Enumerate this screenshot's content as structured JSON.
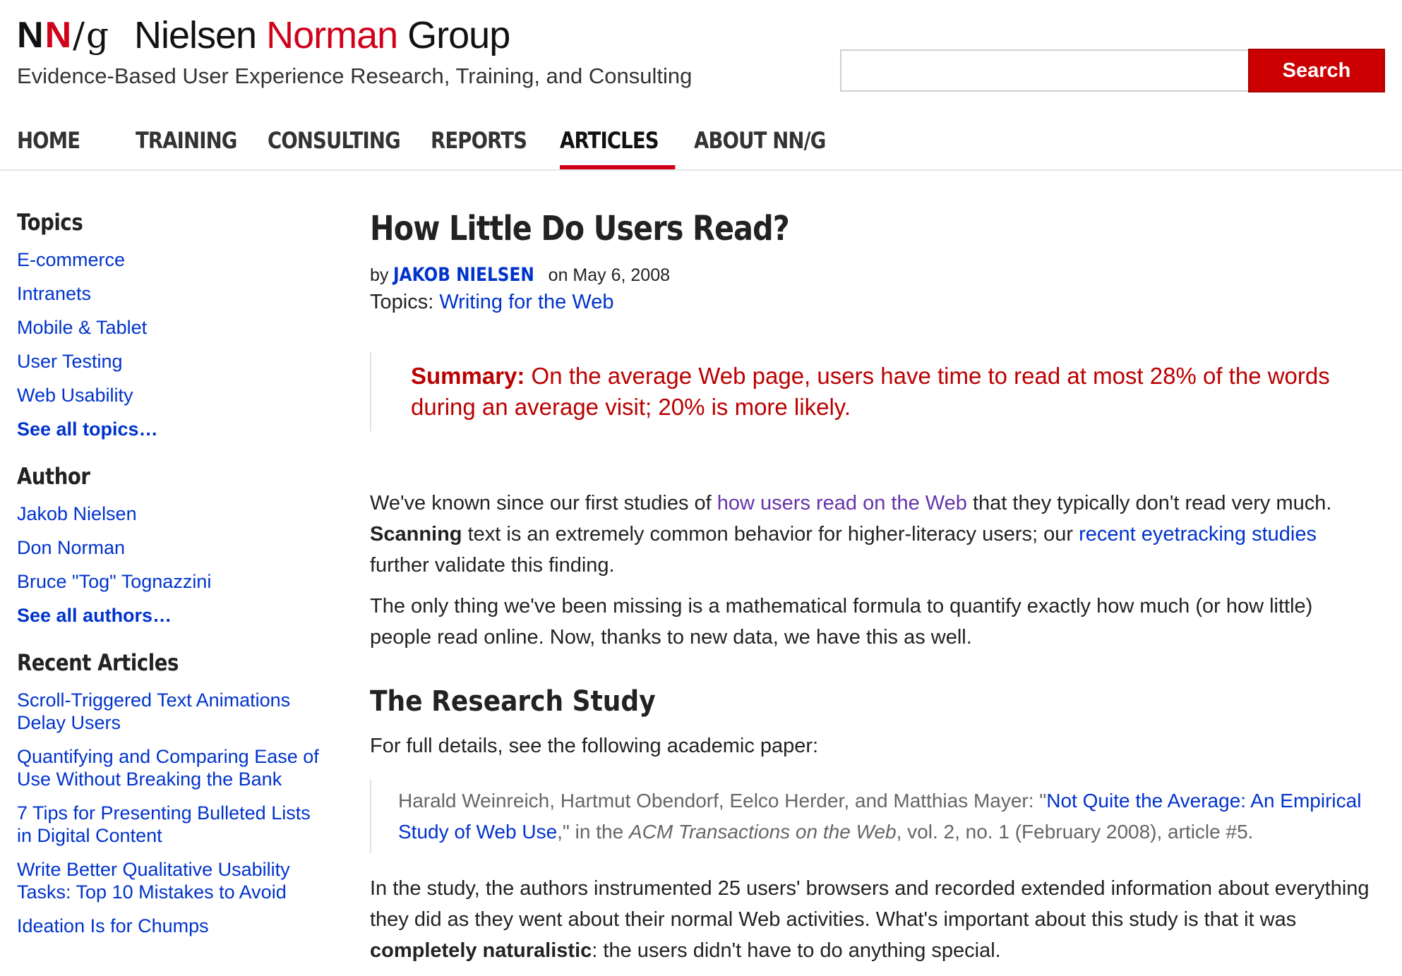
{
  "header": {
    "logo_n1": "N",
    "logo_n2": "N",
    "logo_slash": "/",
    "logo_g": "g",
    "name_part1": "Nielsen ",
    "name_part2": "Norman",
    "name_part3": " Group",
    "tagline": "Evidence-Based User Experience Research, Training, and Consulting",
    "brand_color": "#d0021b"
  },
  "search": {
    "value": "",
    "placeholder": "",
    "button_label": "Search"
  },
  "nav": {
    "items": [
      "HOME",
      "TRAINING",
      "CONSULTING",
      "REPORTS",
      "ARTICLES",
      "ABOUT NN/G"
    ],
    "active": "ARTICLES"
  },
  "sidebar": {
    "topics_heading": "Topics",
    "topics": [
      "E-commerce",
      "Intranets",
      "Mobile & Tablet",
      "User Testing",
      "Web Usability"
    ],
    "topics_more": "See all topics…",
    "author_heading": "Author",
    "authors": [
      "Jakob Nielsen",
      "Don Norman",
      "Bruce \"Tog\" Tognazzini"
    ],
    "authors_more": "See all authors…",
    "recent_heading": "Recent Articles",
    "recent": [
      "Scroll-Triggered Text Animations Delay Users",
      "Quantifying and Comparing Ease of Use Without Breaking the Bank",
      "7 Tips for Presenting Bulleted Lists in Digital Content",
      "Write Better Qualitative Usability Tasks: Top 10 Mistakes to Avoid",
      "Ideation Is for Chumps"
    ]
  },
  "article": {
    "title": "How Little Do Users Read?",
    "by": "by ",
    "author": "JAKOB NIELSEN",
    "date": " on May 6, 2008",
    "topics_label": "Topics: ",
    "topic": "Writing for the Web",
    "summary_label": "Summary:",
    "summary_text": " On the average Web page, users have time to read at most 28% of the words during an average visit; 20% is more likely.",
    "p1_a": "We've known since our first studies of ",
    "p1_link": "how users read on the Web",
    "p1_b": " that they typically don't read very much. ",
    "p1_bold": "Scanning",
    "p1_c": " text is an extremely common behavior for higher-literacy users; our ",
    "p1_link2": "recent eyetracking studies",
    "p1_d": " further validate this finding.",
    "p2": "The only thing we've been missing is a mathematical formula to quantify exactly how much (or how little) people read online. Now, thanks to new data, we have this as well.",
    "h2": "The Research Study",
    "p3": "For full details, see the following academic paper:",
    "cite_a": "Harald Weinreich, Hartmut Obendorf, Eelco Herder, and Matthias Mayer: \"",
    "cite_link": "Not Quite the Average: An Empirical Study of Web Use",
    "cite_b": ",\" in the ",
    "cite_journal": "ACM Transactions on the Web",
    "cite_c": ", vol. 2, no. 1 (February 2008), article #5.",
    "p4_a": "In the study, the authors instrumented 25 users' browsers and recorded extended information about everything they did as they went about their normal Web activities. What's important about this study is that it was ",
    "p4_bold": "completely naturalistic",
    "p4_b": ": the users didn't have to do anything special."
  }
}
